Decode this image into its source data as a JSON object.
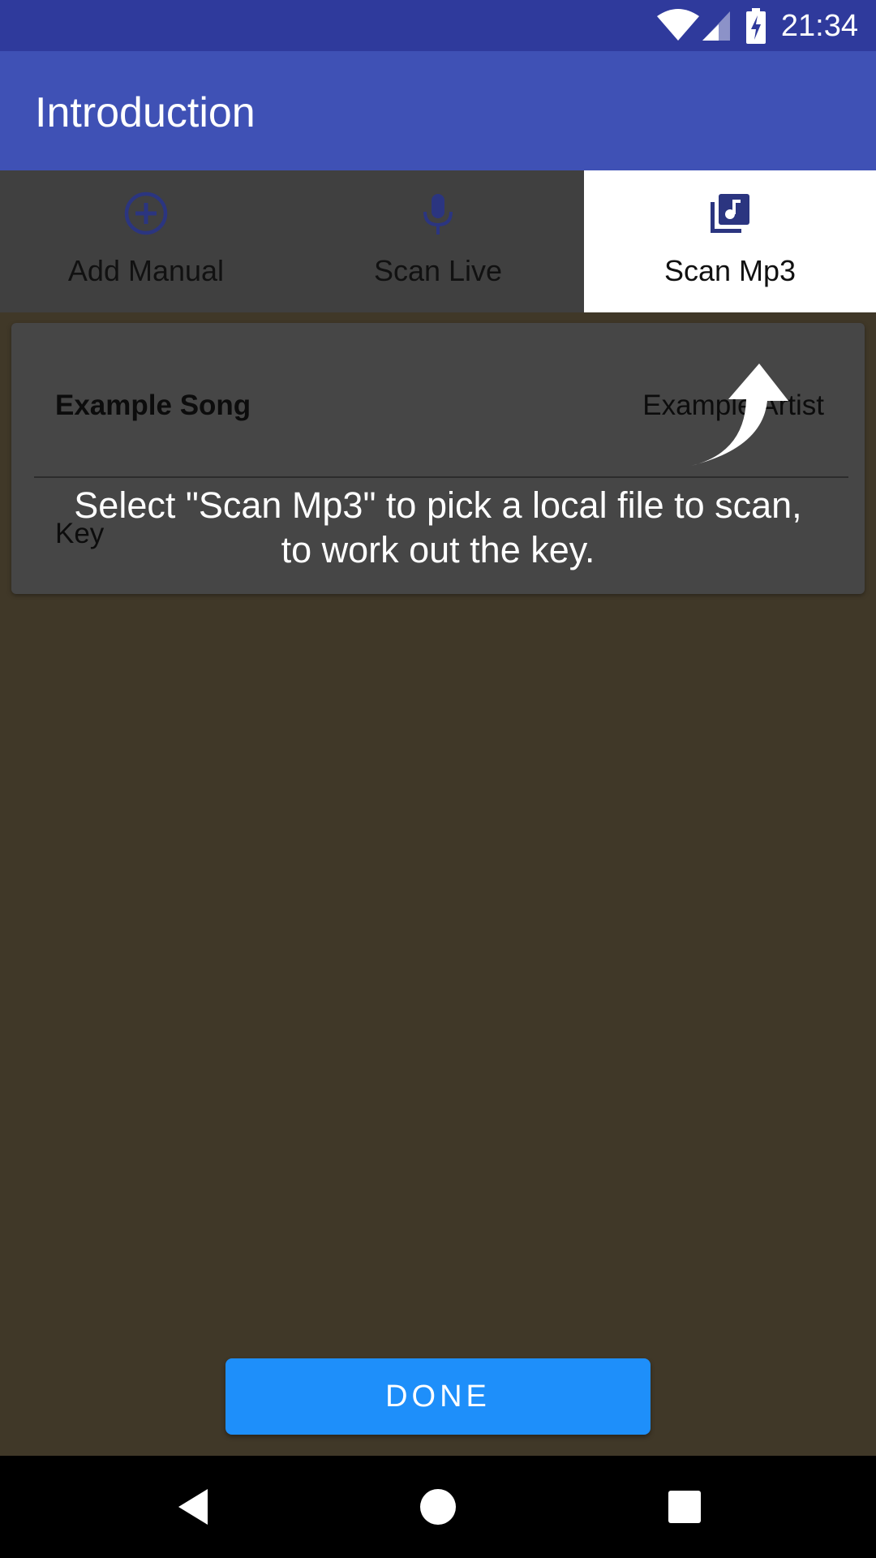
{
  "status_bar": {
    "time": "21:34",
    "icons": [
      "wifi-icon",
      "cell-signal-icon",
      "battery-charging-icon"
    ]
  },
  "app_bar": {
    "title": "Introduction"
  },
  "tabs": [
    {
      "label": "Add Manual",
      "icon": "add-circle-icon",
      "selected": false
    },
    {
      "label": "Scan Live",
      "icon": "microphone-icon",
      "selected": false
    },
    {
      "label": "Scan Mp3",
      "icon": "music-library-icon",
      "selected": true
    }
  ],
  "card": {
    "song_title": "Example Song",
    "song_artist": "Example Artist",
    "key_label": "Key"
  },
  "tip": {
    "text": "Select \"Scan Mp3\" to pick a local file to scan, to work out the key.",
    "icon": "curved-arrow-icon"
  },
  "done_button": {
    "label": "DONE"
  },
  "nav_bar": {
    "icons": [
      "back-icon",
      "home-icon",
      "recents-icon"
    ]
  },
  "colors": {
    "status_bar": "#2f3a9c",
    "app_bar": "#3f51b5",
    "accent": "#1e8ffa",
    "tab_icon": "#2b3580",
    "overlay_background": "#403828"
  }
}
